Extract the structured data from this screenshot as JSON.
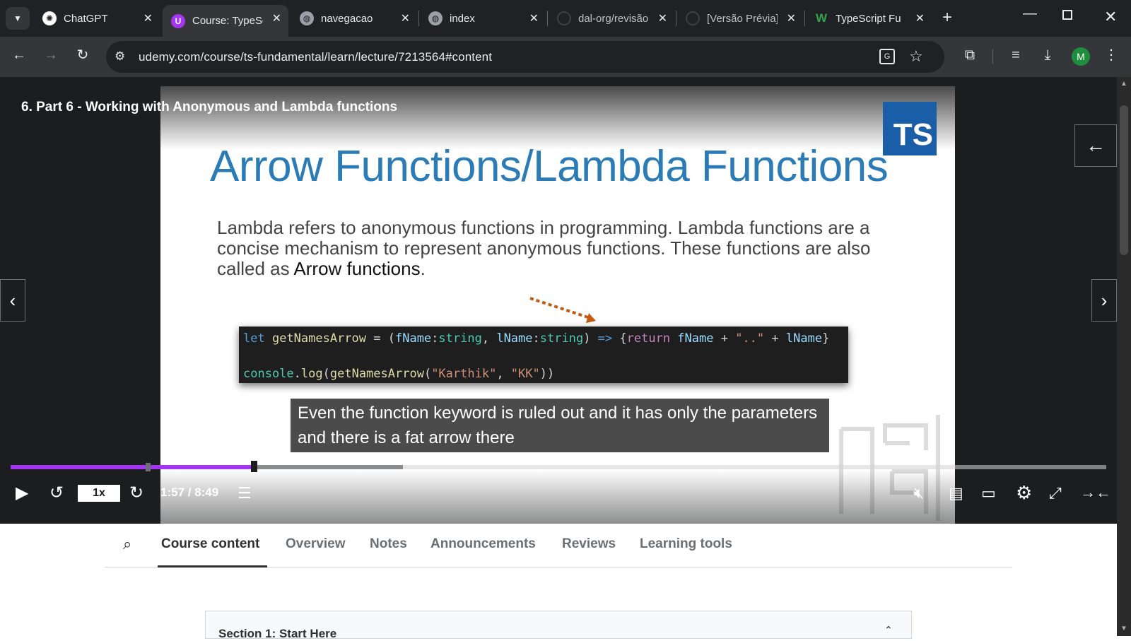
{
  "browser": {
    "tabs": [
      {
        "label": "ChatGPT",
        "icon": "chatgpt-icon"
      },
      {
        "label": "Course: TypeScript",
        "icon": "udemy-icon",
        "active": true
      },
      {
        "label": "navegacao",
        "icon": "globe-icon"
      },
      {
        "label": "index",
        "icon": "globe-icon"
      },
      {
        "label": "dal-org/revisão",
        "icon": "github-icon"
      },
      {
        "label": "[Versão Prévia]",
        "icon": "github-icon"
      },
      {
        "label": "TypeScript Fu",
        "icon": "w-icon"
      }
    ],
    "url": "udemy.com/course/ts-fundamental/learn/lecture/7213564#content",
    "profile_initial": "M"
  },
  "player": {
    "lecture_title": "6. Part 6 - Working with Anonymous and Lambda functions",
    "slide": {
      "logo_text": "TS",
      "title": "Arrow Functions/Lambda Functions",
      "paragraph_plain": "Lambda refers to anonymous functions in programming. Lambda functions are a concise mechanism to represent anonymous functions. These functions are also called as ",
      "paragraph_bold": "Arrow functions",
      "paragraph_end": ".",
      "code": {
        "kw_let": "let",
        "fn_name": "getNamesArrow",
        "eq": " = (",
        "p1": "fName",
        "colon": ":",
        "type1": "string",
        "comma": ", ",
        "p2": "lName",
        "type2": "string",
        "close_paren": ") ",
        "arrow": "=>",
        "open_brace": " {",
        "kw_return": "return",
        "expr_a": " fName",
        "plus1": " + ",
        "sep_str": "\"..\"",
        "plus2": " + ",
        "expr_b": "lName",
        "close_brace": "}",
        "console": "console",
        "dot": ".",
        "log": "log",
        "call_open": "(",
        "call_fn": "getNamesArrow",
        "arg_open": "(",
        "arg1": "\"Karthik\"",
        "arg_sep": ", ",
        "arg2": "\"KK\"",
        "call_close": "))"
      }
    },
    "subtitle": "Even the function keyword is ruled out and it has only the parameters and there is a fat arrow there",
    "progress_fraction": 0.222,
    "speed": "1x",
    "time": "1:57 / 8:49"
  },
  "course_tabs": [
    "Course content",
    "Overview",
    "Notes",
    "Announcements",
    "Reviews",
    "Learning tools"
  ],
  "active_course_tab": "Course content",
  "section_title": "Section 1: Start Here",
  "colors": {
    "accent": "#a435f0",
    "slide_title": "#2b7bb6",
    "ts_logo": "#1a5ea8"
  }
}
